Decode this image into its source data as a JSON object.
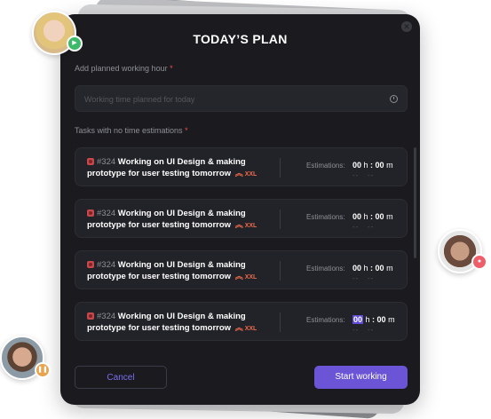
{
  "modal": {
    "title": "TODAY’S PLAN",
    "close_icon": "close-icon"
  },
  "planned_hours": {
    "label": "Add planned working hour",
    "required_mark": "*",
    "placeholder": "Working time planned for today",
    "value": "",
    "icon": "clock-icon"
  },
  "tasks_section": {
    "label": "Tasks with no time estimations",
    "required_mark": "*"
  },
  "tasks": [
    {
      "id": "#324",
      "title": "Working on UI Design & making prototype for user testing tomorrow",
      "priority_icon": "double-chevron-up-icon",
      "size": "XXL",
      "estimation_label": "Estimations:",
      "hours": "00",
      "h_unit": "h",
      "minutes": "00",
      "m_unit": "m",
      "focused": false
    },
    {
      "id": "#324",
      "title": "Working on UI Design & making prototype for user testing tomorrow",
      "priority_icon": "double-chevron-up-icon",
      "size": "XXL",
      "estimation_label": "Estimations:",
      "hours": "00",
      "h_unit": "h",
      "minutes": "00",
      "m_unit": "m",
      "focused": false
    },
    {
      "id": "#324",
      "title": "Working on UI Design & making prototype for user testing tomorrow",
      "priority_icon": "double-chevron-up-icon",
      "size": "XXL",
      "estimation_label": "Estimations:",
      "hours": "00",
      "h_unit": "h",
      "minutes": "00",
      "m_unit": "m",
      "focused": false
    },
    {
      "id": "#324",
      "title": "Working on UI Design & making prototype for user testing tomorrow",
      "priority_icon": "double-chevron-up-icon",
      "size": "XXL",
      "estimation_label": "Estimations:",
      "hours": "00",
      "h_unit": "h",
      "minutes": "00",
      "m_unit": "m",
      "focused": true
    }
  ],
  "buttons": {
    "cancel": "Cancel",
    "start": "Start working"
  },
  "colors": {
    "accent": "#6b55d6",
    "danger": "#ef6a4b",
    "background": "#1b1b1f"
  },
  "avatars": [
    {
      "status_icon": "play-icon",
      "status_color": "#3cba6a"
    },
    {
      "status_icon": "stop-icon",
      "status_color": "#ee5e6b"
    },
    {
      "status_icon": "pause-icon",
      "status_color": "#e7a34d"
    }
  ]
}
